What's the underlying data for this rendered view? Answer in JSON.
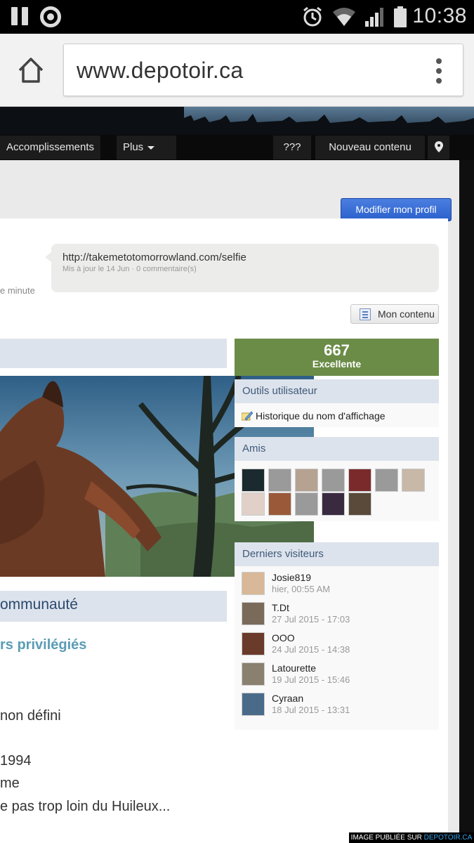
{
  "statusbar": {
    "time": "10:38"
  },
  "browser": {
    "url": "www.depotoir.ca"
  },
  "nav": {
    "accomplissements": "Accomplissements",
    "plus": "Plus",
    "qqq": "???",
    "nouveau": "Nouveau contenu"
  },
  "profile": {
    "edit_button": "Modifier mon profil",
    "status_link": "http://takemetotomorrowland.com/selfie",
    "status_meta": "Mis à jour le 14 Jun · 0 commentaire(s)",
    "minute_text": "e minute",
    "my_content_button": "Mon contenu"
  },
  "reputation": {
    "value": "667",
    "label": "Excellente"
  },
  "tools": {
    "title": "Outils utilisateur",
    "item": "Historique du nom d'affichage"
  },
  "friends": {
    "title": "Amis"
  },
  "visitors": {
    "title": "Derniers visiteurs",
    "items": [
      {
        "name": "Josie819",
        "date": "hier, 00:55 AM"
      },
      {
        "name": "T.Dt",
        "date": "27 Jul 2015 - 17:03"
      },
      {
        "name": "OOO",
        "date": "24 Jul 2015 - 14:38"
      },
      {
        "name": "Latourette",
        "date": "19 Jul 2015 - 15:46"
      },
      {
        "name": "Cyraan",
        "date": "18 Jul 2015 - 13:31"
      }
    ]
  },
  "community": {
    "title": "ommunauté",
    "privileged": "rs privilégiés",
    "lines": [
      "non défini",
      "1994",
      "me",
      "e pas trop loin du Huileux..."
    ]
  },
  "credit": {
    "prefix": "IMAGE PUBLIÉE SUR",
    "site": "DEPOTOIR.CA"
  }
}
